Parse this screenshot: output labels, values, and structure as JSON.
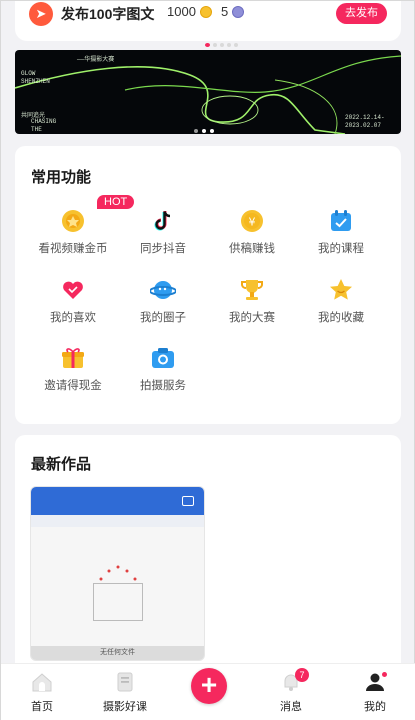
{
  "top_task": {
    "title": "发布100字图文",
    "coins": "1000",
    "gems": "5",
    "button": "去发布"
  },
  "banner": {
    "text_lines": [
      "GLOW",
      "SHENZHEN",
      "共同追光",
      "CHASING",
      "THE",
      "2022.12.14-",
      "2023.02.07",
      "——华摄影大赛"
    ]
  },
  "common_functions": {
    "title": "常用功能",
    "hot_badge": "HOT",
    "items": [
      {
        "label": "看视频赚金币",
        "icon": "coin-icon"
      },
      {
        "label": "同步抖音",
        "icon": "tiktok-icon"
      },
      {
        "label": "供稿赚钱",
        "icon": "yen-coin-icon"
      },
      {
        "label": "我的课程",
        "icon": "calendar-icon"
      },
      {
        "label": "我的喜欢",
        "icon": "heart-icon"
      },
      {
        "label": "我的圈子",
        "icon": "planet-icon"
      },
      {
        "label": "我的大赛",
        "icon": "trophy-icon"
      },
      {
        "label": "我的收藏",
        "icon": "star-icon"
      },
      {
        "label": "邀请得现金",
        "icon": "gift-icon"
      },
      {
        "label": "拍摄服务",
        "icon": "camera-icon"
      }
    ]
  },
  "latest_works": {
    "title": "最新作品",
    "thumb_caption": "无任何文件"
  },
  "tabbar": {
    "items": [
      {
        "label": "首页"
      },
      {
        "label": "摄影好课"
      },
      {
        "label": "消息",
        "badge": "7"
      },
      {
        "label": "我的"
      }
    ],
    "publish_plus": "+"
  },
  "colors": {
    "accent": "#f5285e",
    "gold": "#f7c12e",
    "blue": "#2f9cf0"
  }
}
